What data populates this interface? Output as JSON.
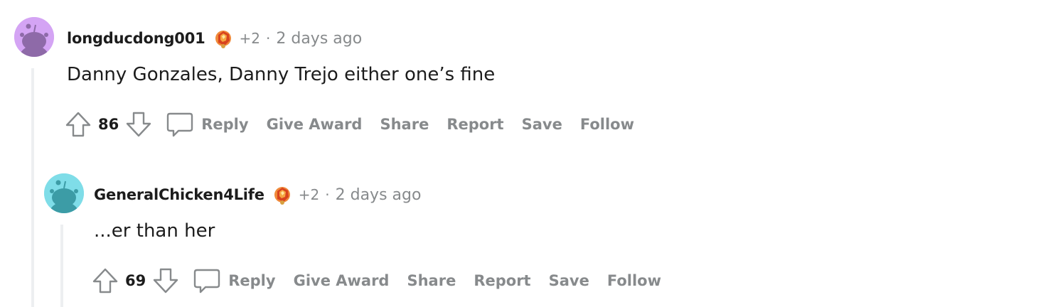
{
  "comments": [
    {
      "username": "longducdong001",
      "award_count": "+2",
      "separator": "·",
      "timestamp": "2 days ago",
      "body": "Danny Gonzales, Danny Trejo either one’s fine",
      "score": "86",
      "avatar_color": "#d4a4f4",
      "actions": {
        "reply": "Reply",
        "give_award": "Give Award",
        "share": "Share",
        "report": "Report",
        "save": "Save",
        "follow": "Follow"
      }
    },
    {
      "username": "GeneralChicken4Life",
      "award_count": "+2",
      "separator": "·",
      "timestamp": "2 days ago",
      "body": "...er than her",
      "score": "69",
      "avatar_color": "#7fdde8",
      "actions": {
        "reply": "Reply",
        "give_award": "Give Award",
        "share": "Share",
        "report": "Report",
        "save": "Save",
        "follow": "Follow"
      }
    }
  ],
  "icons": {
    "upvote": "arrow-up-icon",
    "downvote": "arrow-down-icon",
    "reply": "speech-bubble-icon",
    "award": "award-gem-icon",
    "avatar": "snoo-avatar-icon"
  },
  "colors": {
    "muted_text": "#878a8c",
    "thread_line": "#edeff1",
    "award_orange": "#e0602a"
  }
}
